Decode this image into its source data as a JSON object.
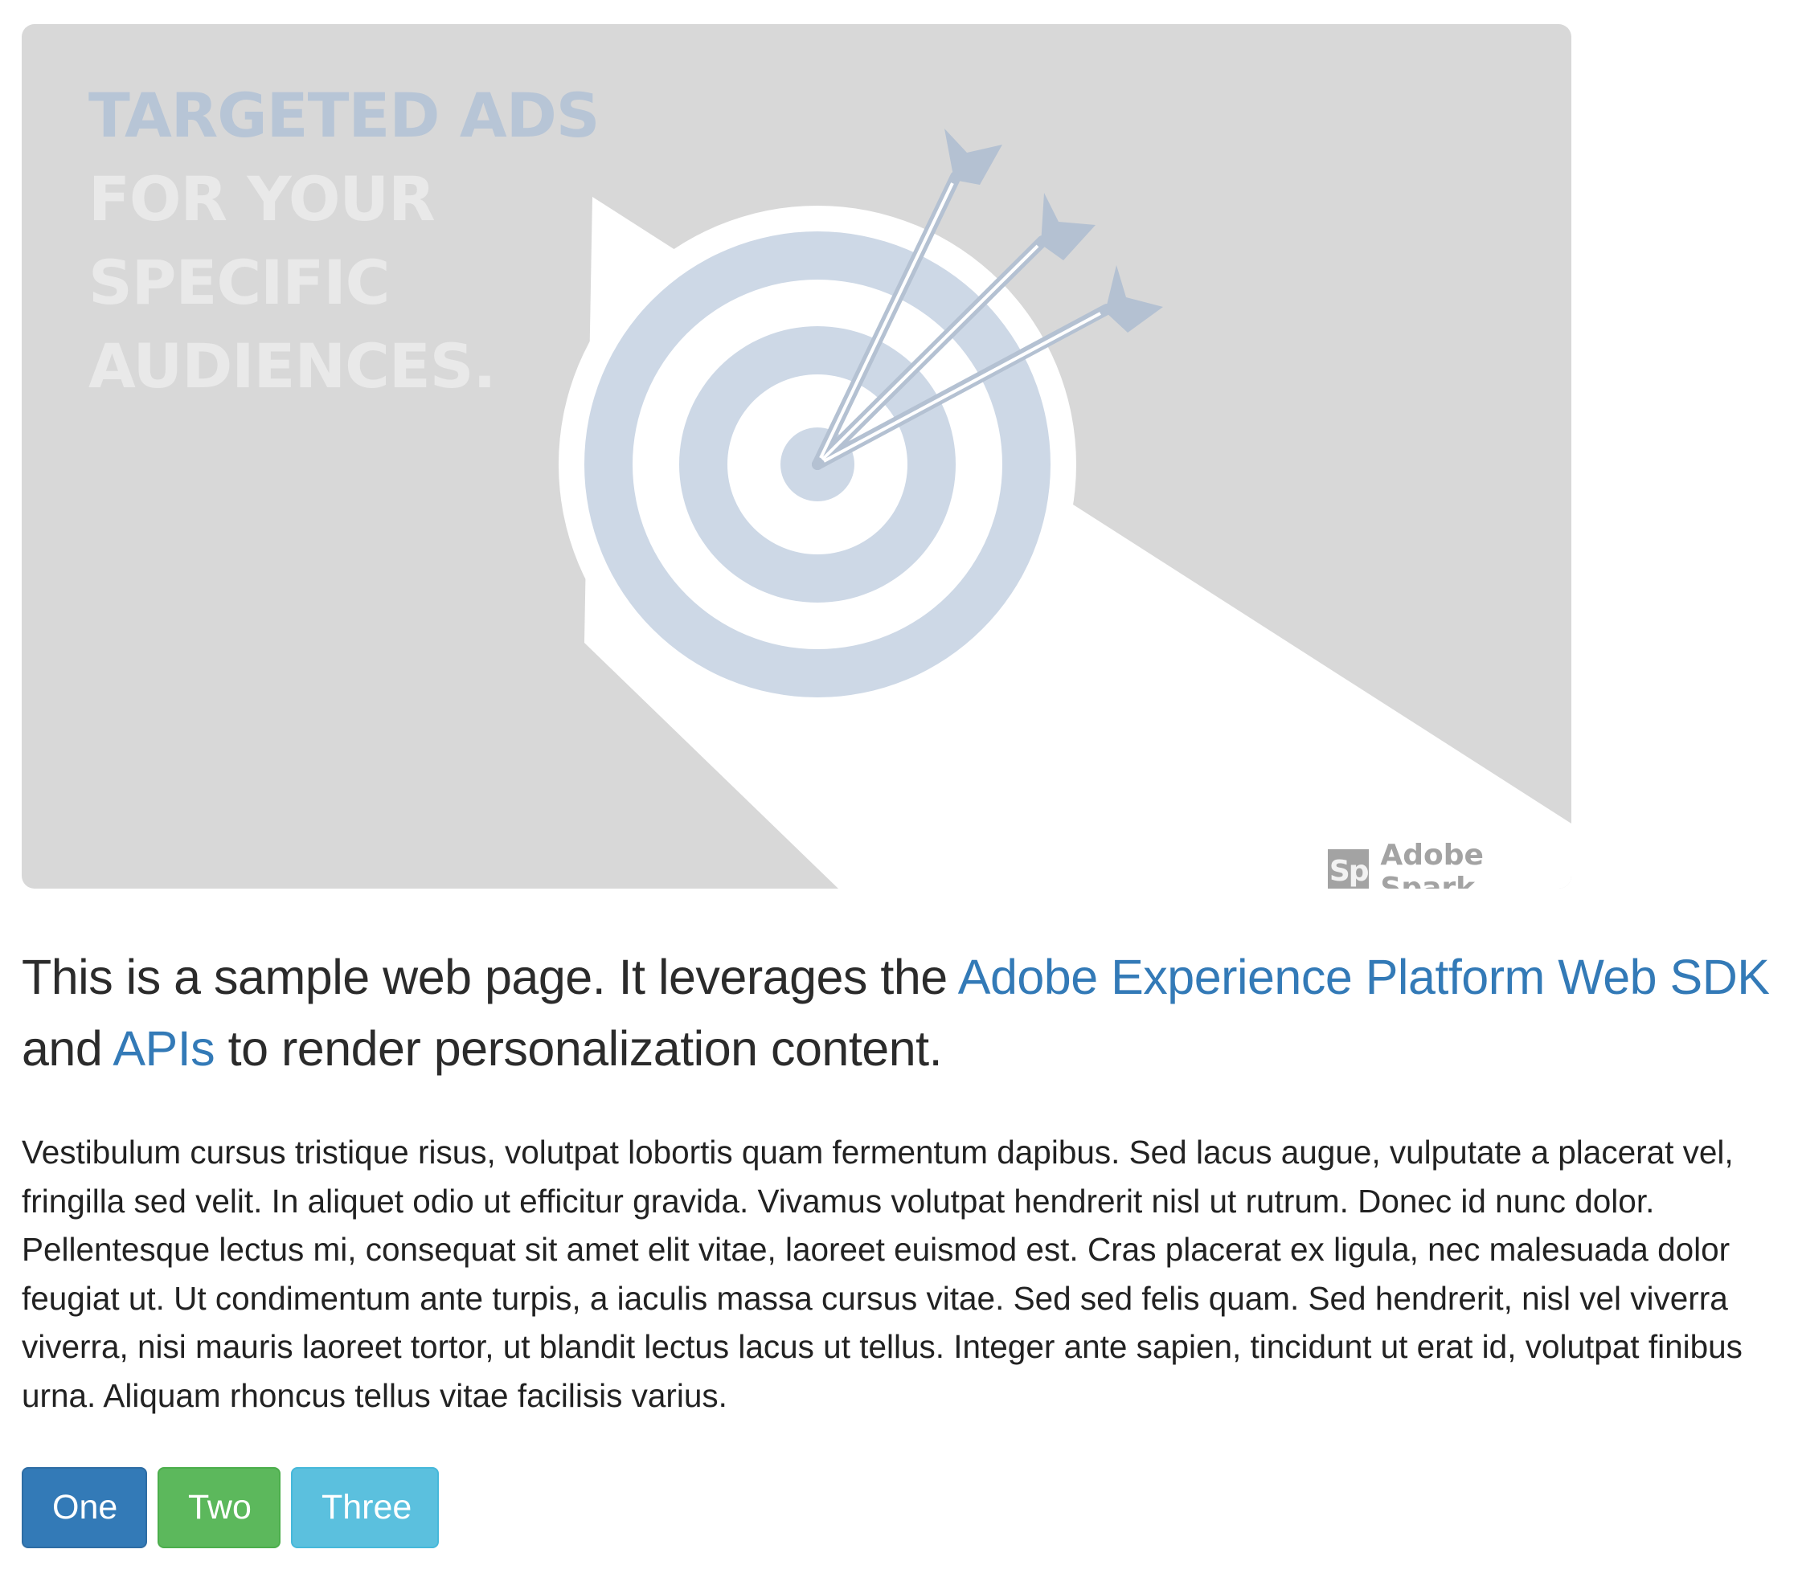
{
  "hero": {
    "headline_lines": [
      "TARGETED ADS",
      "FOR YOUR",
      "SPECIFIC",
      "AUDIENCES."
    ],
    "watermark_logo": "Sp",
    "watermark_text": "Adobe Spark",
    "icon": "target-with-arrows-icon",
    "colors": {
      "background": "#d8d8d8",
      "target": "#cdd8e6",
      "arrows": "#b4c1d2"
    }
  },
  "intro": {
    "text_before": "This is a sample web page. It leverages the ",
    "link1": "Adobe Experience Platform Web SDK",
    "text_middle1": " and ",
    "link2": "APIs",
    "text_after": " to render personalization content.",
    "link_color": "#337ab7"
  },
  "paragraph": "Vestibulum cursus tristique risus, volutpat lobortis quam fermentum dapibus. Sed lacus augue, vulputate a placerat vel, fringilla sed velit. In aliquet odio ut efficitur gravida. Vivamus volutpat hendrerit nisl ut rutrum. Donec id nunc dolor. Pellentesque lectus mi, consequat sit amet elit vitae, laoreet euismod est. Cras placerat ex ligula, nec malesuada dolor feugiat ut. Ut condimentum ante turpis, a iaculis massa cursus vitae. Sed sed felis quam. Sed hendrerit, nisl vel viverra viverra, nisi mauris laoreet tortor, ut blandit lectus lacus ut tellus. Integer ante sapien, tincidunt ut erat id, volutpat finibus urna. Aliquam rhoncus tellus vitae facilisis varius.",
  "buttons": {
    "one": "One",
    "two": "Two",
    "three": "Three",
    "colors": {
      "one": "#337ab7",
      "two": "#5cb85c",
      "three": "#5bc0de"
    }
  }
}
